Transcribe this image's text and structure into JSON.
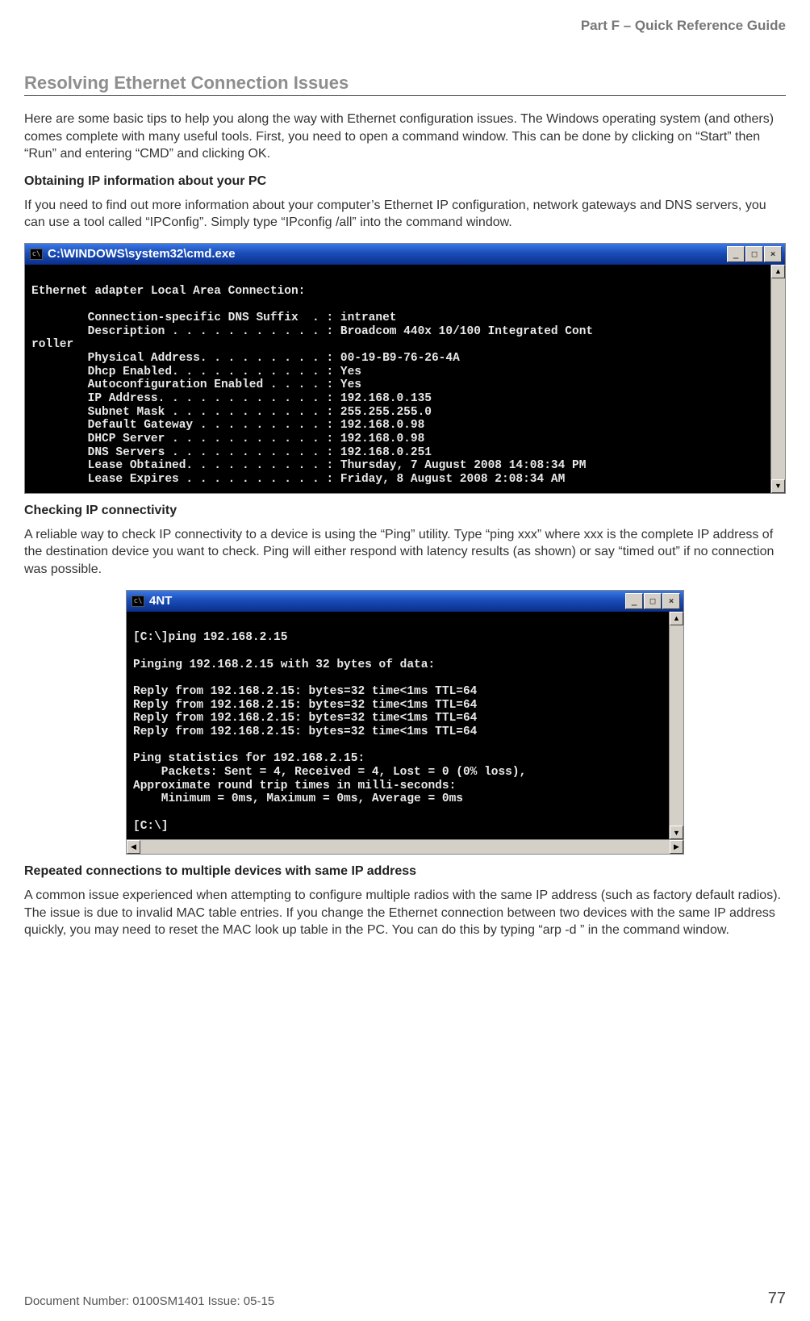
{
  "header": {
    "part": "Part F – Quick Reference Guide"
  },
  "section": {
    "title": "Resolving Ethernet Connection Issues"
  },
  "intro": "Here are some basic tips to help you along the way with Ethernet configuration issues. The Windows operating system (and others) comes complete with many useful tools. First, you need to open a command window. This can be done by clicking on “Start” then “Run” and entering “CMD” and clicking OK.",
  "sub1": {
    "heading": "Obtaining IP information about your PC",
    "text": "If you need to find out more information about your computer’s Ethernet IP configuration, network gateways and DNS servers, you can use a tool called “IPConfig”. Simply type “IPconfig /all” into the command window."
  },
  "cmd1": {
    "title": "C:\\WINDOWS\\system32\\cmd.exe",
    "icon": "c\\",
    "min": "_",
    "max": "□",
    "close": "×",
    "body": "\nEthernet adapter Local Area Connection:\n\n        Connection-specific DNS Suffix  . : intranet\n        Description . . . . . . . . . . . : Broadcom 440x 10/100 Integrated Cont\nroller\n        Physical Address. . . . . . . . . : 00-19-B9-76-26-4A\n        Dhcp Enabled. . . . . . . . . . . : Yes\n        Autoconfiguration Enabled . . . . : Yes\n        IP Address. . . . . . . . . . . . : 192.168.0.135\n        Subnet Mask . . . . . . . . . . . : 255.255.255.0\n        Default Gateway . . . . . . . . . : 192.168.0.98\n        DHCP Server . . . . . . . . . . . : 192.168.0.98\n        DNS Servers . . . . . . . . . . . : 192.168.0.251\n        Lease Obtained. . . . . . . . . . : Thursday, 7 August 2008 14:08:34 PM\n        Lease Expires . . . . . . . . . . : Friday, 8 August 2008 2:08:34 AM\n"
  },
  "sub2": {
    "heading": "Checking IP connectivity",
    "text": "A reliable way to check IP connectivity to a device is using the “Ping” utility. Type “ping xxx” where xxx is the complete IP address of the destination device you want to check. Ping will either respond with latency results (as shown) or say “timed out” if no connection was possible."
  },
  "cmd2": {
    "title": "4NT",
    "icon": "c\\",
    "min": "_",
    "max": "□",
    "close": "×",
    "body": "\n[C:\\]ping 192.168.2.15\n\nPinging 192.168.2.15 with 32 bytes of data:\n\nReply from 192.168.2.15: bytes=32 time<1ms TTL=64\nReply from 192.168.2.15: bytes=32 time<1ms TTL=64\nReply from 192.168.2.15: bytes=32 time<1ms TTL=64\nReply from 192.168.2.15: bytes=32 time<1ms TTL=64\n\nPing statistics for 192.168.2.15:\n    Packets: Sent = 4, Received = 4, Lost = 0 (0% loss),\nApproximate round trip times in milli-seconds:\n    Minimum = 0ms, Maximum = 0ms, Average = 0ms\n\n[C:\\]\n",
    "left_arrow": "◀",
    "right_arrow": "▶",
    "up_arrow": "▲",
    "down_arrow": "▼"
  },
  "sub3": {
    "heading": "Repeated connections to multiple devices with same IP address",
    "text": "A common issue experienced when attempting to configure multiple radios with the same IP address (such as factory default radios). The issue is due to invalid MAC table entries. If you change the Ethernet connection between two devices with the same IP address quickly, you may need to reset the MAC look up table in the PC. You can do this by typing “arp -d ” in the command window."
  },
  "footer": {
    "doc": "Document Number: 0100SM1401   Issue: 05-15",
    "page": "77"
  }
}
